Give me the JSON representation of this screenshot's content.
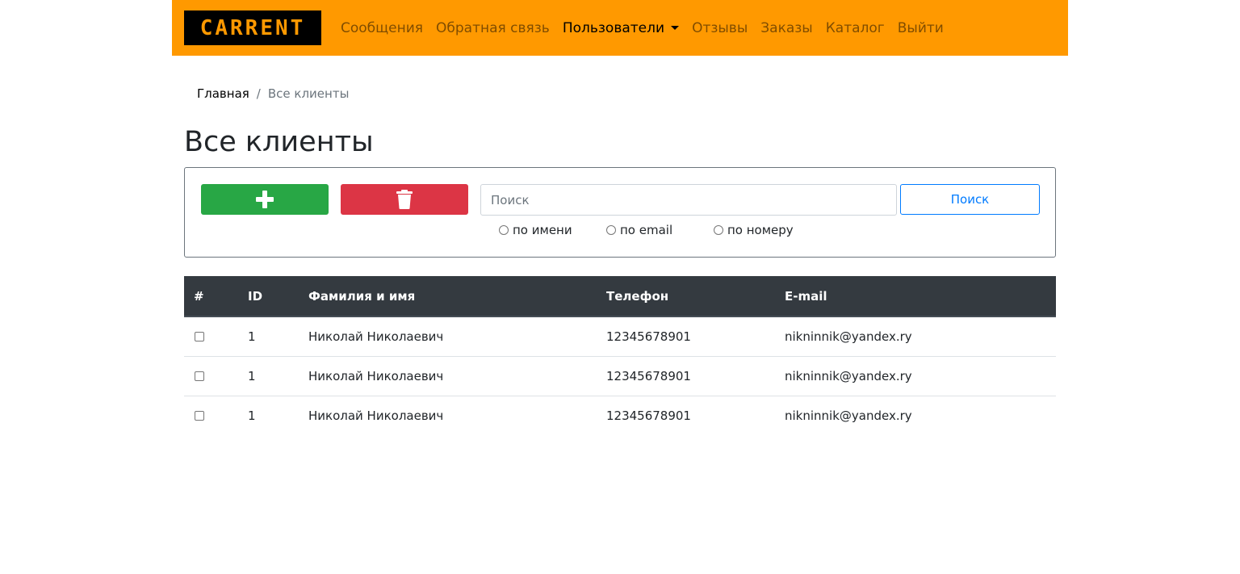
{
  "navbar": {
    "logo_text": "CARRENT",
    "links": [
      {
        "label": "Сообщения"
      },
      {
        "label": "Обратная связь"
      },
      {
        "label": "Пользователи",
        "active": true,
        "dropdown": true
      },
      {
        "label": "Отзывы"
      },
      {
        "label": "Заказы"
      },
      {
        "label": "Каталог"
      },
      {
        "label": "Выйти"
      }
    ],
    "background_color": "#ff9900"
  },
  "breadcrumb": {
    "home": "Главная",
    "separator": "/",
    "current": "Все клиенты"
  },
  "page_title": "Все клиенты",
  "toolbox": {
    "add_button": {
      "icon": "plus-icon",
      "color": "#28a745"
    },
    "delete_button": {
      "icon": "trash-icon",
      "color": "#dc3545"
    },
    "search": {
      "placeholder": "Поиск",
      "value": "",
      "button_label": "Поиск"
    },
    "search_options": [
      {
        "label": "по имени",
        "checked": false
      },
      {
        "label": "по email",
        "checked": false
      },
      {
        "label": "по номеру",
        "checked": false
      }
    ]
  },
  "table": {
    "columns": [
      "#",
      "ID",
      "Фамилия и имя",
      "Телефон",
      "E-mail"
    ],
    "rows": [
      {
        "checked": false,
        "id": "1",
        "name": "Николай Николаевич",
        "phone": "12345678901",
        "email": "nikninnik@yandex.ry"
      },
      {
        "checked": false,
        "id": "1",
        "name": "Николай Николаевич",
        "phone": "12345678901",
        "email": "nikninnik@yandex.ry"
      },
      {
        "checked": false,
        "id": "1",
        "name": "Николай Николаевич",
        "phone": "12345678901",
        "email": "nikninnik@yandex.ry"
      }
    ]
  }
}
